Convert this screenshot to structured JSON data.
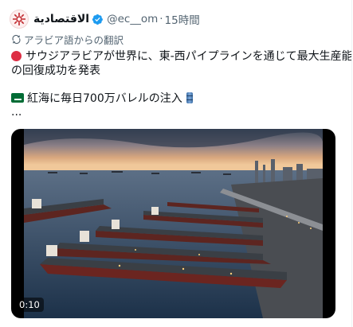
{
  "tweet": {
    "display_name": "الاقتصادية",
    "handle": "@ec__om",
    "separator": "·",
    "time": "15時間",
    "translation_note": "アラビア語からの翻訳",
    "text_line1": "サウジアラビアが世界に、東-西パイプラインを通じて最大生産能力",
    "text_line2": "の回復成功を発表",
    "text_line3": "紅海に毎日700万バレルの注入",
    "ellipsis": "...",
    "avatar_icon": "eqtisadiah-logo-icon",
    "verified_icon": "verified-badge-icon",
    "emoji_1": "red-circle-icon",
    "emoji_2": "saudi-flag-icon",
    "emoji_3": "oil-barrel-icon"
  },
  "media": {
    "type": "video",
    "timestamp": "0:10"
  },
  "colors": {
    "verified": "#1d9bf0",
    "secondary_text": "#536471",
    "primary_text": "#0f1419",
    "brand_red": "#c0282d"
  }
}
